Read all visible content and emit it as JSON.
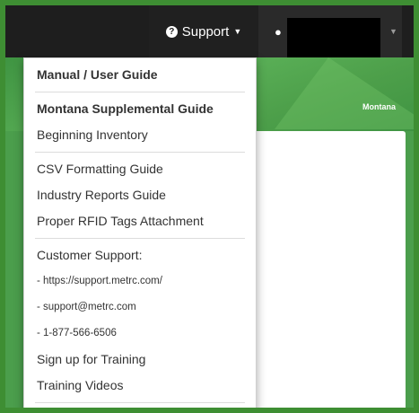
{
  "navbar": {
    "support_label": "Support",
    "support_icon": "question-circle-icon",
    "user_icon": "user-icon"
  },
  "hero": {
    "state_label": "Montana"
  },
  "dropdown": {
    "items": [
      {
        "label": "Manual / User Guide"
      },
      {
        "label": "Montana Supplemental Guide"
      },
      {
        "label": "Beginning Inventory"
      },
      {
        "label": "CSV Formatting Guide"
      },
      {
        "label": "Industry Reports Guide"
      },
      {
        "label": "Proper RFID Tags Attachment"
      },
      {
        "label": "Customer Support:"
      },
      {
        "label": "- https://support.metrc.com/"
      },
      {
        "label": "- support@metrc.com"
      },
      {
        "label": "- 1-877-566-6506"
      },
      {
        "label": "Sign up for Training"
      },
      {
        "label": "Training Videos"
      }
    ]
  },
  "colors": {
    "navbar_bg": "#1e1e1e",
    "frame_green": "#3e8e33",
    "hero_green": "#4b9e4c"
  }
}
